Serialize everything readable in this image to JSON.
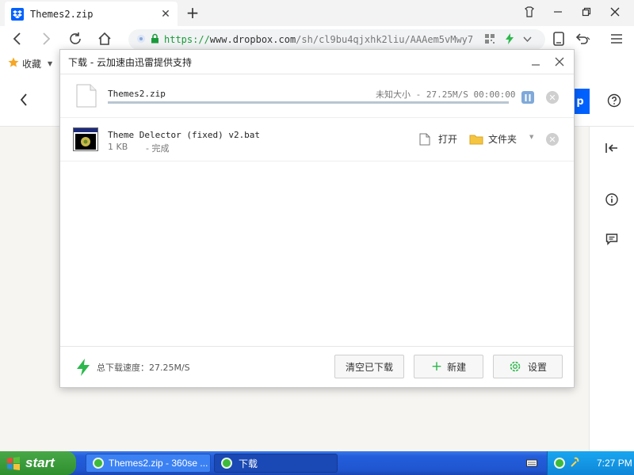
{
  "browser": {
    "tab_title": "Themes2.zip",
    "url_proto": "https://",
    "url_host": "www.dropbox.com",
    "url_path": "/sh/cl9bu4qjxhk2liu/AAAem5vMwy7",
    "bookmarks_label": "收藏"
  },
  "page": {
    "button_partial": "p"
  },
  "dialog": {
    "title": "下载 - 云加速由迅雷提供支持",
    "items": [
      {
        "name": "Themes2.zip",
        "status": "未知大小 - 27.25M/S 00:00:00",
        "progress": 1.0
      },
      {
        "name": "Theme Delector (fixed) v2.bat",
        "size": "1 KB",
        "status": "- 完成",
        "open_label": "打开",
        "folder_label": "文件夹"
      }
    ],
    "footer": {
      "speed_label": "总下载速度：27.25M/S",
      "clear_label": "清空已下载",
      "new_label": "新建",
      "settings_label": "设置"
    }
  },
  "taskbar": {
    "start_label": "start",
    "tasks": [
      {
        "label": "Themes2.zip - 360se ..."
      },
      {
        "label": "下载"
      }
    ],
    "clock": "7:27 PM"
  },
  "colors": {
    "accent": "#0061fe",
    "progress": "#b9c6d3",
    "speed_icon": "#2db84d",
    "folder": "#f5c542"
  }
}
